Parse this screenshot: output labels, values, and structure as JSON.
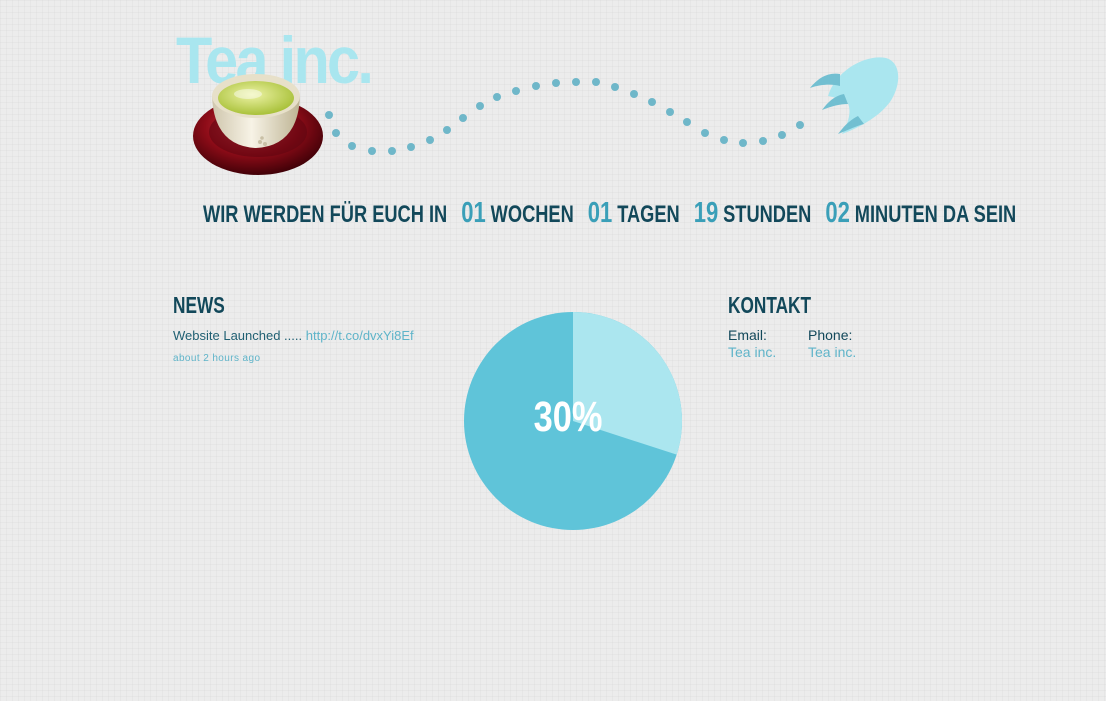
{
  "brand": {
    "title": "Tea inc."
  },
  "countdown": {
    "prefix": "Wir werden für euch in",
    "weeks_value": "01",
    "weeks_label": "Wochen",
    "days_value": "01",
    "days_label": "Tagen",
    "hours_value": "19",
    "hours_label": "Stunden",
    "minutes_value": "02",
    "minutes_label": "Minuten da sein"
  },
  "news": {
    "title": "News",
    "item_text": "Website Launched ..... ",
    "item_link": "http://t.co/dvxYi8Ef",
    "item_time": "about 2 hours ago"
  },
  "progress": {
    "label": "30%",
    "percent": 30
  },
  "contact": {
    "title": "Kontakt",
    "email_label": "Email:",
    "email_value": "Tea inc.",
    "phone_label": "Phone:",
    "phone_value": "Tea inc."
  },
  "icons": {
    "teacup": "teacup-icon",
    "rocket": "rocket-icon"
  },
  "colors": {
    "background": "#ececec",
    "dark_teal": "#12485a",
    "accent_teal": "#3a9fb8",
    "light_cyan": "#a9e6ef",
    "pie_fill": "#5fc4d9",
    "pie_progress": "#abe6ef",
    "link": "#5fb4c9",
    "dots": "#6fb7c9"
  }
}
